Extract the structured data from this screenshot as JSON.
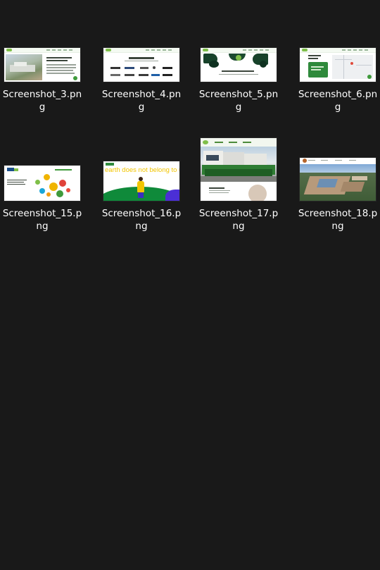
{
  "files": [
    {
      "name": "Screenshot_3.png",
      "thumb": "waste-management"
    },
    {
      "name": "Screenshot_4.png",
      "thumb": "clients"
    },
    {
      "name": "Screenshot_5.png",
      "thumb": "green-hero"
    },
    {
      "name": "Screenshot_6.png",
      "thumb": "info-map"
    },
    {
      "name": "Screenshot_15.png",
      "thumb": "ppli-bubbles"
    },
    {
      "name": "Screenshot_16.png",
      "thumb": "earth-poster",
      "headline": "earth does not belong to us"
    },
    {
      "name": "Screenshot_17.png",
      "thumb": "trucks-crew"
    },
    {
      "name": "Screenshot_18.png",
      "thumb": "landfill-aerial"
    }
  ],
  "colors": {
    "background": "#191919",
    "text": "#ffffff",
    "brand_green": "#3f9a3b",
    "earth_yellow": "#f2c500"
  }
}
